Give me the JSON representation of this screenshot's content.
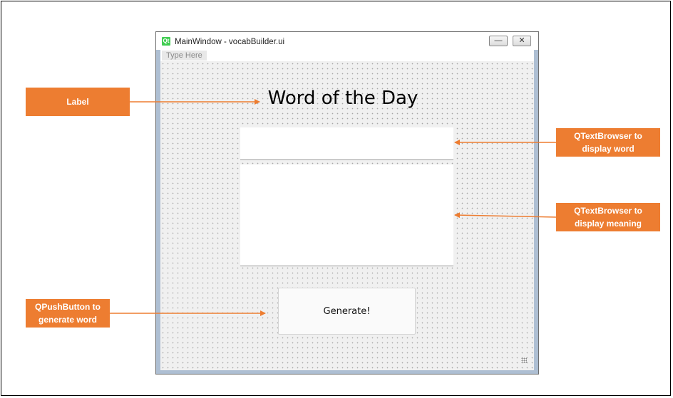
{
  "window": {
    "logo_text": "Qt",
    "title": "MainWindow - vocabBuilder.ui",
    "minimize_glyph": "—",
    "close_glyph": "✕"
  },
  "menubar": {
    "placeholder": "Type Here"
  },
  "form": {
    "label_text": "Word of the Day",
    "word_display": "",
    "meaning_display": "",
    "generate_label": "Generate!"
  },
  "annotations": {
    "label": "Label",
    "word_browser": "QTextBrowser to display word",
    "meaning_browser": "QTextBrowser to display meaning",
    "push_button": "QPushButton to generate word"
  },
  "colors": {
    "annotation": "#ed7d31",
    "qt_logo": "#41cd52",
    "canvas": "#f0f0f0"
  }
}
